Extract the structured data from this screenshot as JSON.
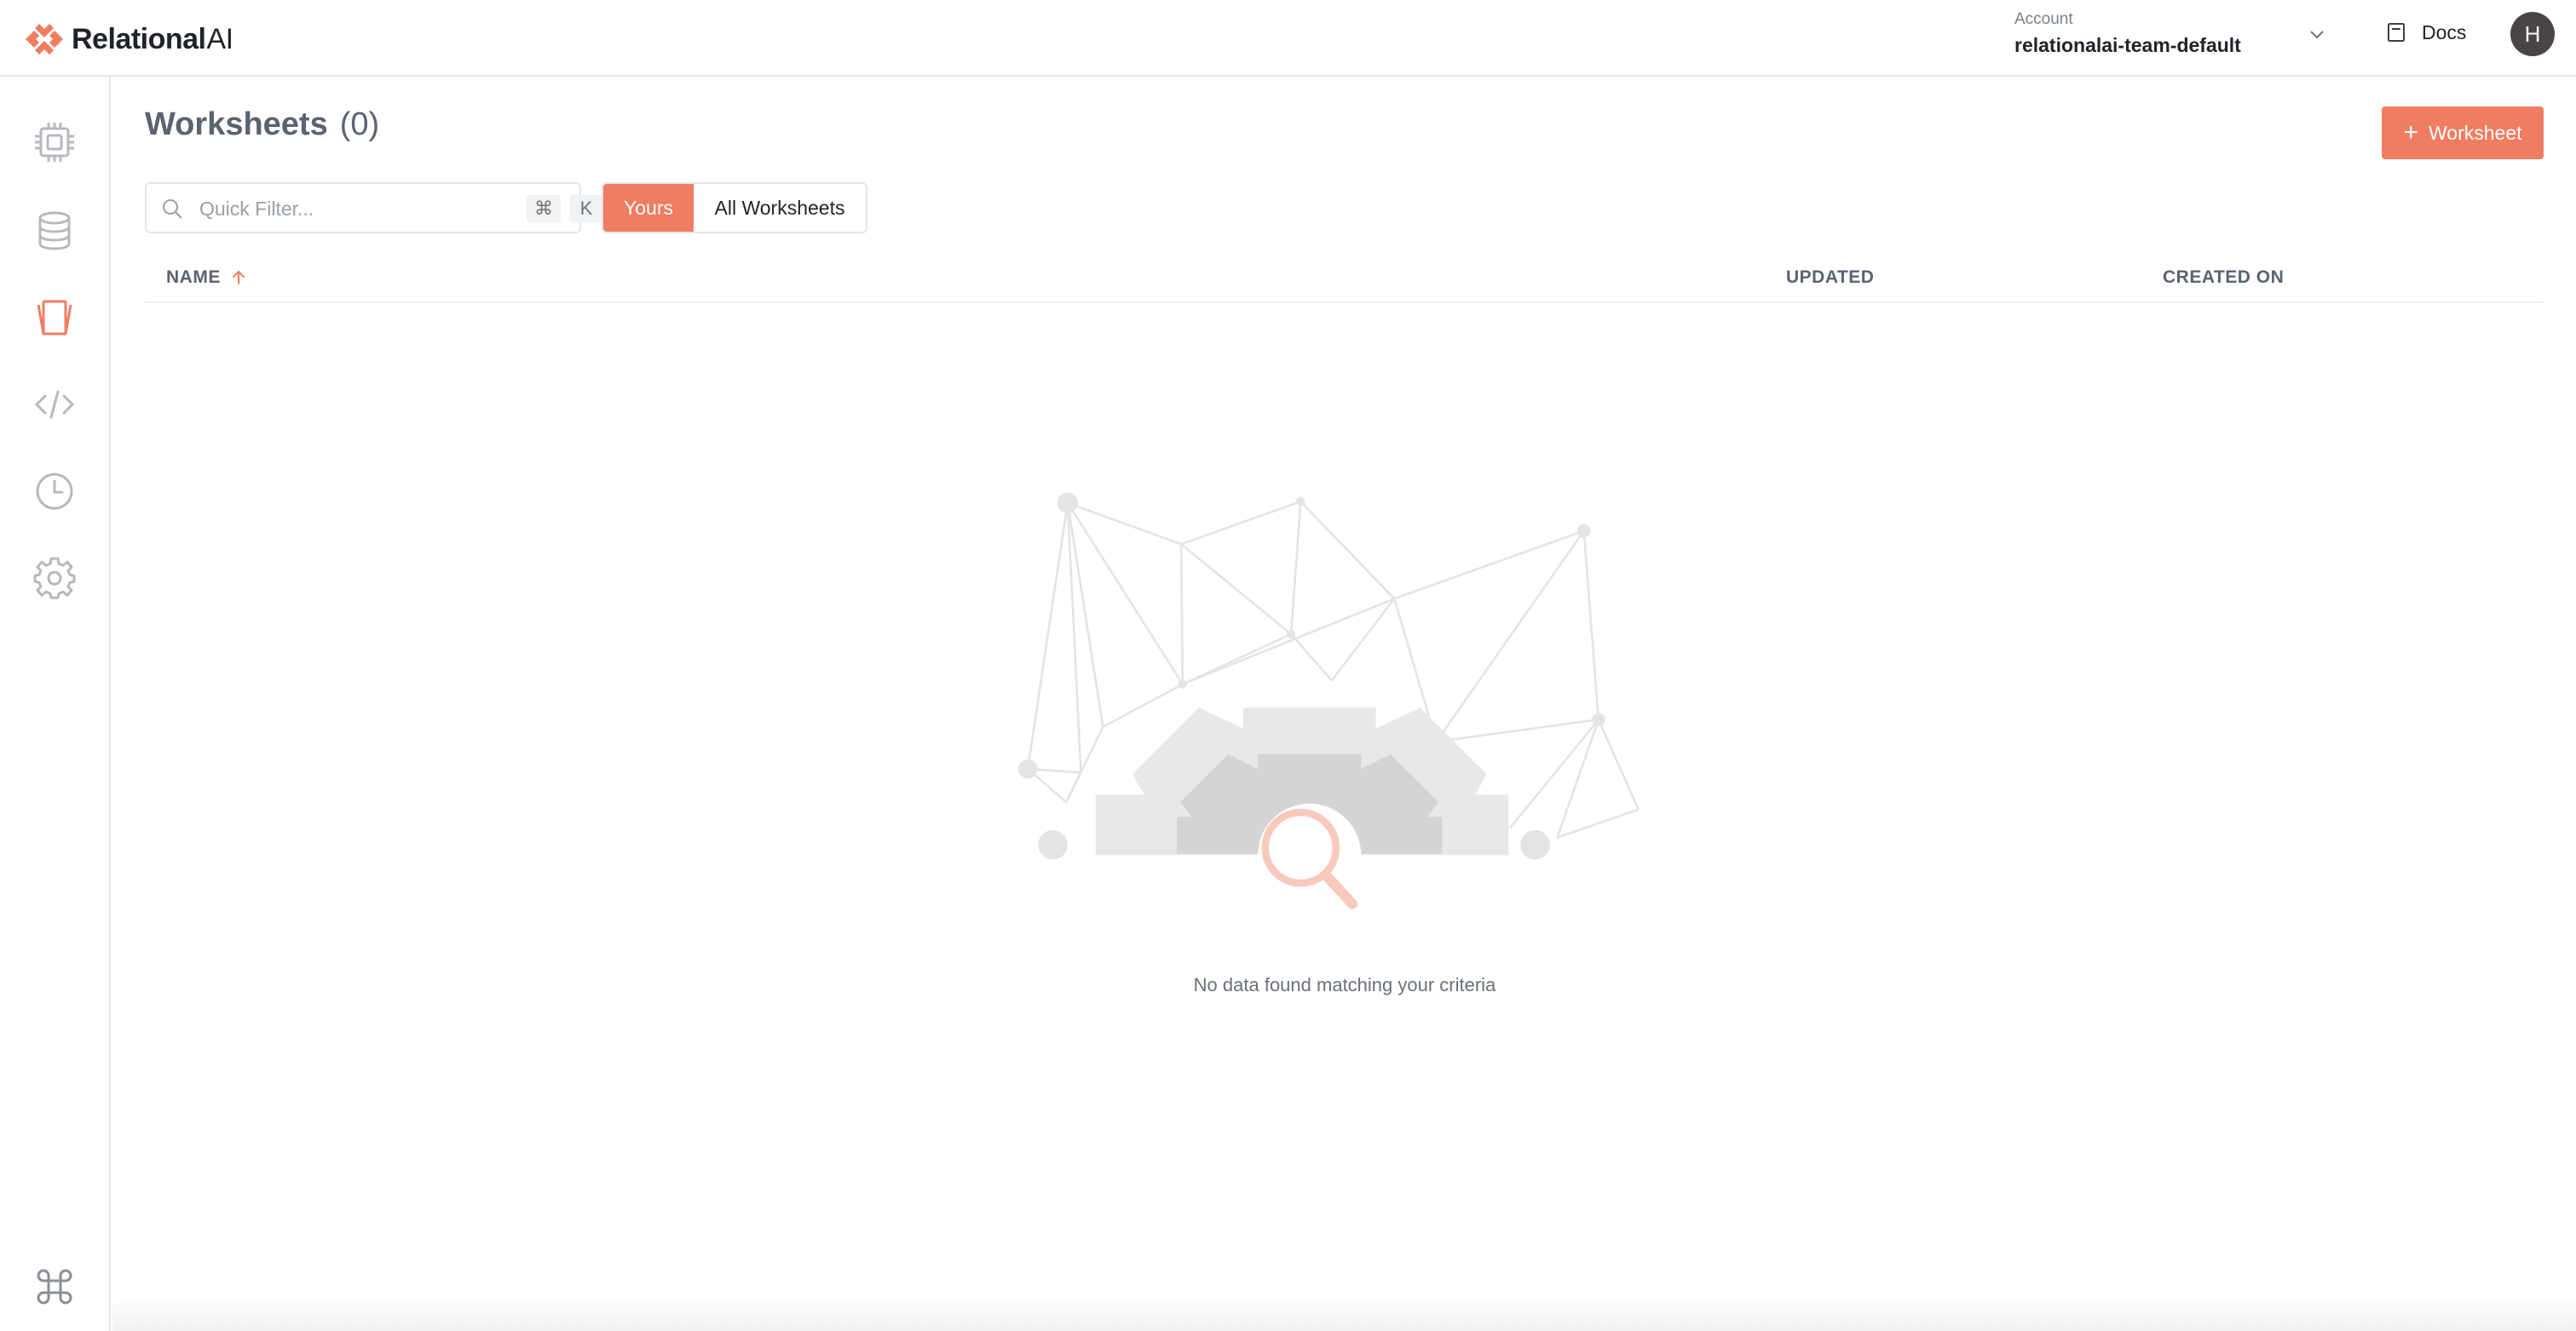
{
  "brand": {
    "name_main": "Relational",
    "name_suffix": "AI",
    "accent_color": "#f07c62"
  },
  "header": {
    "account_label": "Account",
    "account_name": "relationalai-team-default",
    "docs_label": "Docs",
    "avatar_initial": "H"
  },
  "sidebar": {
    "items": [
      {
        "name": "engines",
        "icon": "cpu-chip-icon",
        "active": false
      },
      {
        "name": "databases",
        "icon": "database-icon",
        "active": false
      },
      {
        "name": "worksheets",
        "icon": "worksheets-icon",
        "active": true
      },
      {
        "name": "code",
        "icon": "code-icon",
        "active": false
      },
      {
        "name": "history",
        "icon": "clock-icon",
        "active": false
      },
      {
        "name": "settings",
        "icon": "gear-icon",
        "active": false
      }
    ],
    "footer_icon": "command-key-icon"
  },
  "page": {
    "title": "Worksheets",
    "count": "(0)",
    "new_button_label": "Worksheet"
  },
  "filter": {
    "placeholder": "Quick Filter...",
    "shortcut_mod": "⌘",
    "shortcut_key": "K"
  },
  "scope_toggle": {
    "options": [
      "Yours",
      "All Worksheets"
    ],
    "selected": "Yours"
  },
  "table": {
    "columns": [
      "NAME",
      "UPDATED",
      "CREATED ON"
    ],
    "sort_column": "NAME",
    "sort_direction": "ascending",
    "rows": []
  },
  "empty_state": {
    "message": "No data found matching your criteria"
  }
}
